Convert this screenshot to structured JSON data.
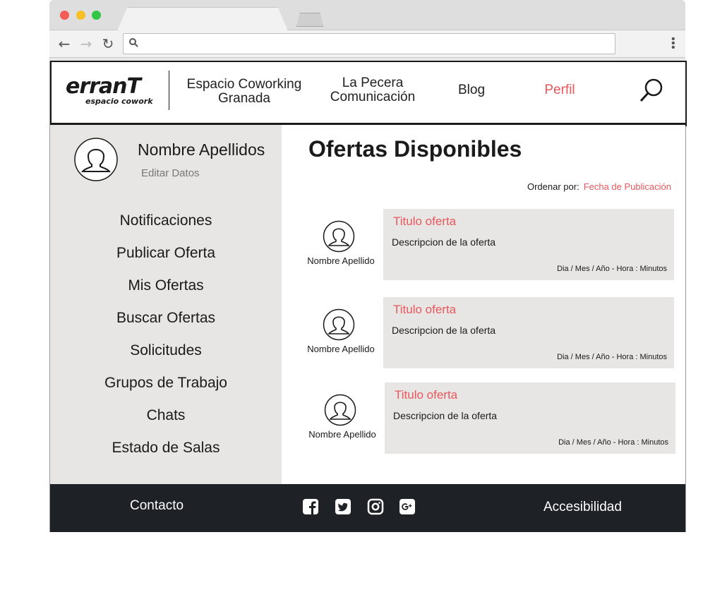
{
  "header": {
    "logo_main": "erranT",
    "logo_sub": "espacio cowork",
    "nav": [
      {
        "label_line1": "Espacio Coworking",
        "label_line2": "Granada"
      },
      {
        "label_line1": "La Pecera",
        "label_line2": "Comunicación"
      },
      {
        "label_line1": "Blog"
      },
      {
        "label_line1": "Perfil"
      }
    ],
    "active_color": "#e8575c"
  },
  "sidebar": {
    "user_name": "Nombre Apellidos",
    "edit_label": "Editar Datos",
    "menu": [
      "Notificaciones",
      "Publicar Oferta",
      "Mis Ofertas",
      "Buscar Ofertas",
      "Solicitudes",
      "Grupos de Trabajo",
      "Chats",
      "Estado de Salas"
    ]
  },
  "main": {
    "title": "Ofertas Disponibles",
    "sort_label": "Ordenar por:",
    "sort_value": "Fecha de Publicación",
    "offers": [
      {
        "author": "Nombre Apellido",
        "title": "Titulo oferta",
        "description": "Descripcion de la oferta",
        "date": "Dia / Mes / Año - Hora : Minutos"
      },
      {
        "author": "Nombre Apellido",
        "title": "Titulo oferta",
        "description": "Descripcion de la oferta",
        "date": "Dia / Mes / Año - Hora : Minutos"
      },
      {
        "author": "Nombre Apellido",
        "title": "Titulo oferta",
        "description": "Descripcion de la oferta",
        "date": "Dia / Mes / Año - Hora : Minutos"
      }
    ]
  },
  "footer": {
    "contact": "Contacto",
    "accessibility": "Accesibilidad",
    "social_icons": [
      "facebook-icon",
      "twitter-icon",
      "instagram-icon",
      "google-plus-icon"
    ]
  }
}
